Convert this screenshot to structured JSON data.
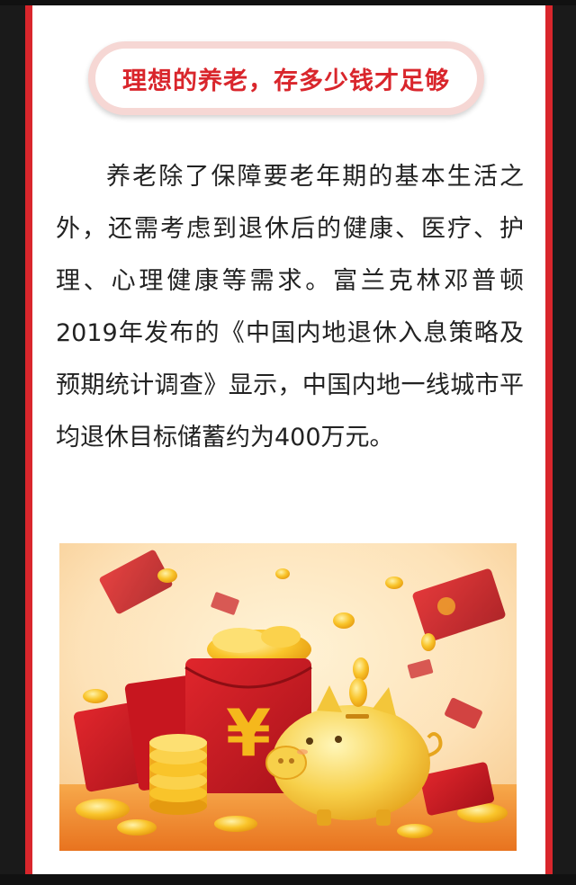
{
  "article": {
    "title": "理想的养老，存多少钱才足够",
    "paragraph": "养老除了保障要老年期的基本生活之外，还需考虑到退休后的健康、医疗、护理、心理健康等需求。富兰克林邓普顿2019年发布的《中国内地退休入息策略及预期统计调查》显示，中国内地一线城市平均退休目标储蓄约为400万元。"
  },
  "illustration": {
    "symbol": "¥",
    "icons": [
      "red-envelope-icon",
      "gold-coin-icon",
      "piggy-bank-icon",
      "ingot-icon"
    ]
  },
  "colors": {
    "accent": "#d9262c",
    "title_bg": "#f6d7d4",
    "text": "#222222",
    "gold": "#f5b81c"
  }
}
